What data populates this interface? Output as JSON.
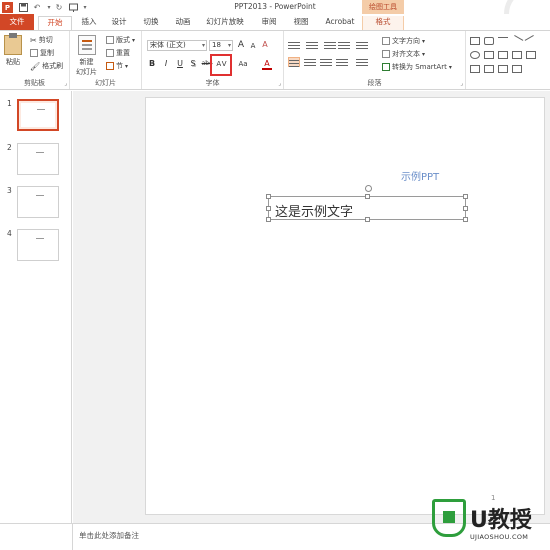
{
  "titlebar": {
    "app_icon": "powerpoint-logo",
    "title": "PPT2013 - PowerPoint",
    "context_tab_group": "绘图工具",
    "quick_access": [
      "save-icon",
      "undo-icon",
      "redo-icon",
      "slideshow-icon"
    ]
  },
  "tabs": [
    {
      "label": "文件",
      "active": false
    },
    {
      "label": "开始",
      "active": true
    },
    {
      "label": "插入",
      "active": false
    },
    {
      "label": "设计",
      "active": false
    },
    {
      "label": "切换",
      "active": false
    },
    {
      "label": "动画",
      "active": false
    },
    {
      "label": "幻灯片放映",
      "active": false
    },
    {
      "label": "审阅",
      "active": false
    },
    {
      "label": "视图",
      "active": false
    },
    {
      "label": "Acrobat",
      "active": false
    },
    {
      "label": "格式",
      "active": false
    }
  ],
  "ribbon": {
    "clipboard": {
      "label": "剪贴板",
      "paste": "粘贴",
      "cut": "剪切",
      "copy": "复制",
      "format_painter": "格式刷"
    },
    "slides": {
      "label": "幻灯片",
      "new_slide_line1": "新建",
      "new_slide_line2": "幻灯片",
      "layout": "版式",
      "reset": "重置",
      "section": "节"
    },
    "font": {
      "label": "字体",
      "font_name": "宋体 (正文)",
      "font_size": "18",
      "grow": "A",
      "shrink": "A",
      "clear": "A",
      "bold": "B",
      "italic": "I",
      "underline": "U",
      "shadow": "S",
      "strike": "abc",
      "char_spacing": "AV",
      "change_case": "Aa",
      "font_color": "A"
    },
    "paragraph": {
      "label": "段落",
      "text_direction": "文字方向",
      "align_text": "对齐文本",
      "smartart": "转换为 SmartArt"
    }
  },
  "slides_panel": [
    {
      "number": "1",
      "active": true
    },
    {
      "number": "2",
      "active": false
    },
    {
      "number": "3",
      "active": false
    },
    {
      "number": "4",
      "active": false
    }
  ],
  "slide": {
    "title": "示例PPT",
    "body_text": "这是示例文字",
    "page_number": "1"
  },
  "notes": {
    "placeholder": "单击此处添加备注"
  },
  "watermark": {
    "brand": "U教授",
    "url": "UJIAOSHOU.COM"
  },
  "colors": {
    "accent": "#d24726",
    "title_text": "#6b8fc9",
    "highlight_box": "#e03030",
    "watermark_green": "#2e9e3c"
  }
}
